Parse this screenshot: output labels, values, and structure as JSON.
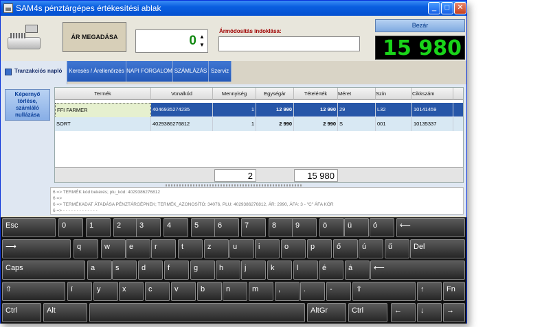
{
  "window": {
    "title": "SAM4s pénztárgépes értékesítési ablak",
    "minimize": "_",
    "maximize": "□",
    "close": "✕"
  },
  "top": {
    "price_button": "ÁR MEGADÁSA",
    "quantity": "0",
    "spin_up": "▲",
    "spin_down": "▼",
    "price_mod_label": "Ármódosítás indoklása:",
    "price_mod_value": "",
    "close_button": "Bezár",
    "total_display": "15 980"
  },
  "tabs": [
    {
      "label": "Tranzakciós napló",
      "active": true
    },
    {
      "label": "Keresés / Árellenőrzés",
      "active": false
    },
    {
      "label": "NAPI FORGALOM",
      "active": false
    },
    {
      "label": "SZÁMLÁZÁS",
      "active": false
    },
    {
      "label": "Szerviz",
      "active": false
    }
  ],
  "side": {
    "reset_button": "Képernyő törlése, számláló nullázása"
  },
  "grid": {
    "columns": [
      "Termék",
      "Vonalkód",
      "Mennyiség",
      "Egységár",
      "Tételérték",
      "Méret",
      "Szín",
      "Cikkszám"
    ],
    "rows": [
      {
        "termek": "FFI FARMER",
        "vonalkod": "4046935274235",
        "mennyiseg": "1",
        "egysegar": "12 990",
        "tetelertek": "12 990",
        "meret": "29",
        "szin": "L32",
        "cikkszam": "10141459"
      },
      {
        "termek": "SORT",
        "vonalkod": "4029386276812",
        "mennyiseg": "1",
        "egysegar": "2 990",
        "tetelertek": "2 990",
        "meret": "S",
        "szin": "001",
        "cikkszam": "10135337"
      }
    ],
    "footer_qty": "2",
    "footer_total": "15 980"
  },
  "log": [
    "6 => TERMÉK kód bekérés; plu_kód: 4029386276812",
    "6 =>",
    "6 => TERMÉKADAT ÁTADÁSA PÉNZTÁRGÉPNEK; TERMÉK_AZONOSÍTÓ: 34076, PLU: 4029386276812, ÁR: 2990, ÁFA: 3 - \"C\" ÁFA KÖR",
    "6 => - - - - - - - - - - - - -"
  ],
  "keyboard": {
    "row1": [
      "Esc",
      "0",
      "1",
      "2",
      "3",
      "4",
      "5",
      "6",
      "7",
      "8",
      "9",
      "ö",
      "ü",
      "ó",
      "⟵"
    ],
    "row2": [
      "⟶",
      "q",
      "w",
      "e",
      "r",
      "t",
      "z",
      "u",
      "i",
      "o",
      "p",
      "ő",
      "ú",
      "ű",
      "Del"
    ],
    "row3": [
      "Caps",
      "a",
      "s",
      "d",
      "f",
      "g",
      "h",
      "j",
      "k",
      "l",
      "é",
      "á",
      "⟵"
    ],
    "row4": [
      "⇧",
      "í",
      "y",
      "x",
      "c",
      "v",
      "b",
      "n",
      "m",
      ",",
      ".",
      "-",
      "⇧",
      "↑",
      "Fn"
    ],
    "row5": [
      "Ctrl",
      "Alt",
      "",
      "AltGr",
      "Ctrl",
      "←",
      "↓",
      "→"
    ]
  }
}
